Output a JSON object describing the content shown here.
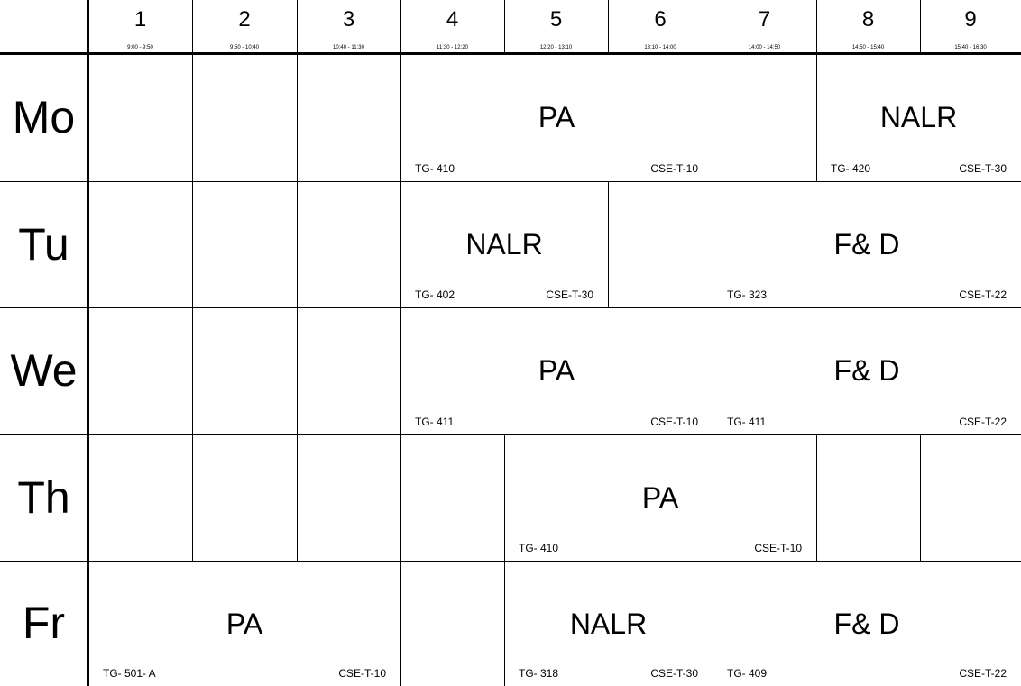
{
  "periods": [
    {
      "num": "1",
      "time": "9:00 - 9:50"
    },
    {
      "num": "2",
      "time": "9:50 - 10:40"
    },
    {
      "num": "3",
      "time": "10:40 - 11:30"
    },
    {
      "num": "4",
      "time": "11:30 - 12:20"
    },
    {
      "num": "5",
      "time": "12:20 - 13:10"
    },
    {
      "num": "6",
      "time": "13:10 - 14:00"
    },
    {
      "num": "7",
      "time": "14:00 - 14:50"
    },
    {
      "num": "8",
      "time": "14:50 - 15:40"
    },
    {
      "num": "9",
      "time": "15:40 - 16:30"
    }
  ],
  "days": [
    {
      "name": "Mo",
      "cells": [
        {
          "start": 1,
          "span": 1
        },
        {
          "start": 2,
          "span": 1
        },
        {
          "start": 3,
          "span": 1
        },
        {
          "start": 4,
          "span": 3,
          "subject": "PA",
          "group": "TG- 410",
          "room": "CSE-T-10"
        },
        {
          "start": 7,
          "span": 1
        },
        {
          "start": 8,
          "span": 2,
          "subject": "NALR",
          "group": "TG- 420",
          "room": "CSE-T-30"
        }
      ]
    },
    {
      "name": "Tu",
      "cells": [
        {
          "start": 1,
          "span": 1
        },
        {
          "start": 2,
          "span": 1
        },
        {
          "start": 3,
          "span": 1
        },
        {
          "start": 4,
          "span": 2,
          "subject": "NALR",
          "group": "TG- 402",
          "room": "CSE-T-30"
        },
        {
          "start": 6,
          "span": 1
        },
        {
          "start": 7,
          "span": 3,
          "subject": "F& D",
          "group": "TG- 323",
          "room": "CSE-T-22"
        }
      ]
    },
    {
      "name": "We",
      "cells": [
        {
          "start": 1,
          "span": 1
        },
        {
          "start": 2,
          "span": 1
        },
        {
          "start": 3,
          "span": 1
        },
        {
          "start": 4,
          "span": 3,
          "subject": "PA",
          "group": "TG- 411",
          "room": "CSE-T-10"
        },
        {
          "start": 7,
          "span": 3,
          "subject": "F& D",
          "group": "TG- 411",
          "room": "CSE-T-22"
        }
      ]
    },
    {
      "name": "Th",
      "cells": [
        {
          "start": 1,
          "span": 1
        },
        {
          "start": 2,
          "span": 1
        },
        {
          "start": 3,
          "span": 1
        },
        {
          "start": 4,
          "span": 1
        },
        {
          "start": 5,
          "span": 3,
          "subject": "PA",
          "group": "TG- 410",
          "room": "CSE-T-10"
        },
        {
          "start": 8,
          "span": 1
        },
        {
          "start": 9,
          "span": 1
        }
      ]
    },
    {
      "name": "Fr",
      "cells": [
        {
          "start": 1,
          "span": 3,
          "subject": "PA",
          "group": "TG- 501- A",
          "room": "CSE-T-10"
        },
        {
          "start": 4,
          "span": 1
        },
        {
          "start": 5,
          "span": 2,
          "subject": "NALR",
          "group": "TG- 318",
          "room": "CSE-T-30"
        },
        {
          "start": 7,
          "span": 3,
          "subject": "F& D",
          "group": "TG- 409",
          "room": "CSE-T-22"
        }
      ]
    }
  ]
}
